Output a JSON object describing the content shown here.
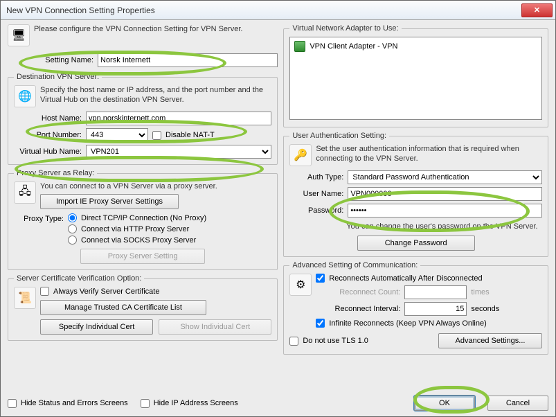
{
  "window": {
    "title": "New VPN Connection Setting Properties"
  },
  "intro": "Please configure the VPN Connection Setting for VPN Server.",
  "setting": {
    "name_lbl": "Setting Name:",
    "name": "Norsk Internett"
  },
  "dest": {
    "legend": "Destination VPN Server:",
    "desc": "Specify the host name or IP address, and the port number and the Virtual Hub on the destination VPN Server.",
    "host_lbl": "Host Name:",
    "host": "vpn.norskinternett.com",
    "port_lbl": "Port Number:",
    "port": "443",
    "disable_natt": "Disable NAT-T",
    "hub_lbl": "Virtual Hub Name:",
    "hub": "VPN201"
  },
  "proxy": {
    "legend": "Proxy Server as Relay:",
    "desc": "You can connect to a VPN Server via a proxy server.",
    "import_btn": "Import IE Proxy Server Settings",
    "type_lbl": "Proxy Type:",
    "opt_direct": "Direct TCP/IP Connection (No Proxy)",
    "opt_http": "Connect via HTTP Proxy Server",
    "opt_socks": "Connect via SOCKS Proxy Server",
    "settings_btn": "Proxy Server Setting"
  },
  "cert": {
    "legend": "Server Certificate Verification Option:",
    "always": "Always Verify Server Certificate",
    "manage_btn": "Manage Trusted CA Certificate List",
    "spec_btn": "Specify Individual Cert",
    "show_btn": "Show Individual Cert"
  },
  "adapter": {
    "legend": "Virtual Network Adapter to Use:",
    "item": "VPN Client Adapter - VPN"
  },
  "auth": {
    "legend": "User Authentication Setting:",
    "desc": "Set the user authentication information that is required when connecting to the VPN Server.",
    "type_lbl": "Auth Type:",
    "type": "Standard Password Authentication",
    "user_lbl": "User Name:",
    "user": "VPN000000",
    "pass_lbl": "Password:",
    "pass": "••••••",
    "note": "You can change the user's password on the VPN Server.",
    "change_btn": "Change Password"
  },
  "adv": {
    "legend": "Advanced Setting of Communication:",
    "reconnect": "Reconnects Automatically After Disconnected",
    "count_lbl": "Reconnect Count:",
    "count_suffix": "times",
    "interval_lbl": "Reconnect Interval:",
    "interval": "15",
    "interval_suffix": "seconds",
    "infinite": "Infinite Reconnects (Keep VPN Always Online)",
    "no_tls": "Do not use TLS 1.0",
    "adv_btn": "Advanced Settings..."
  },
  "bottom": {
    "hide_status": "Hide Status and Errors Screens",
    "hide_ip": "Hide IP Address Screens",
    "ok": "OK",
    "cancel": "Cancel"
  }
}
